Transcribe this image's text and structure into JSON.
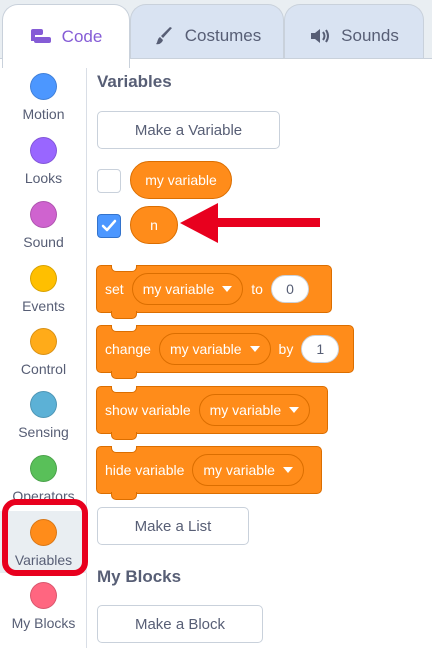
{
  "tabs": {
    "code": "Code",
    "costumes": "Costumes",
    "sounds": "Sounds"
  },
  "categories": [
    {
      "label": "Motion",
      "color": "#4c97ff"
    },
    {
      "label": "Looks",
      "color": "#9966ff"
    },
    {
      "label": "Sound",
      "color": "#cf63cf"
    },
    {
      "label": "Events",
      "color": "#ffbf00"
    },
    {
      "label": "Control",
      "color": "#ffab19"
    },
    {
      "label": "Sensing",
      "color": "#5cb1d6"
    },
    {
      "label": "Operators",
      "color": "#59c059"
    },
    {
      "label": "Variables",
      "color": "#ff8c1a"
    },
    {
      "label": "My Blocks",
      "color": "#ff6680"
    }
  ],
  "selected_category": "Variables",
  "palette": {
    "variables_title": "Variables",
    "make_variable": "Make a Variable",
    "var_my_variable": "my variable",
    "var_n": "n",
    "set_block": {
      "verb": "set",
      "var": "my variable",
      "joiner": "to",
      "value": "0"
    },
    "change_block": {
      "verb": "change",
      "var": "my variable",
      "joiner": "by",
      "value": "1"
    },
    "show_block": {
      "verb": "show variable",
      "var": "my variable"
    },
    "hide_block": {
      "verb": "hide variable",
      "var": "my variable"
    },
    "make_list": "Make a List",
    "myblocks_title": "My Blocks",
    "make_block": "Make a Block"
  },
  "checkboxes": {
    "my_variable": false,
    "n": true
  },
  "colors": {
    "accent": "#855cd6",
    "variables": "#ff8c1a",
    "highlight": "#e8001e",
    "checkbox": "#4c97ff"
  }
}
